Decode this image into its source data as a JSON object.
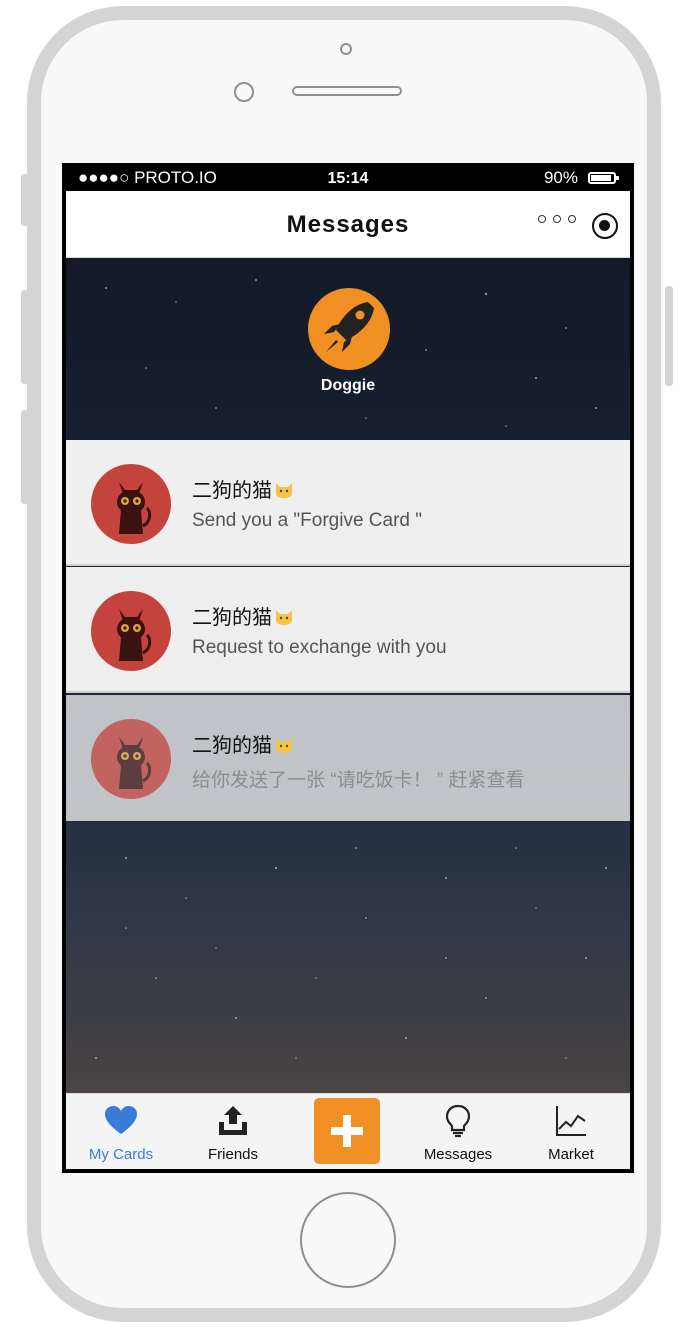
{
  "status": {
    "carrier": "●●●●○ PROTO.IO",
    "time": "15:14",
    "battery": "90%"
  },
  "nav": {
    "title": "Messages"
  },
  "header": {
    "name": "Doggie"
  },
  "messages": [
    {
      "name": "二狗的猫",
      "text": "Send you a \"Forgive Card \""
    },
    {
      "name": "二狗的猫",
      "text": "Request to exchange with you"
    },
    {
      "name": "二狗的猫",
      "text": "给你发送了一张 “请吃饭卡！ ” 赶紧查看"
    }
  ],
  "tabs": [
    {
      "label": "My Cards",
      "icon": "heart-icon",
      "active": true
    },
    {
      "label": "Friends",
      "icon": "upload-icon"
    },
    {
      "label": "",
      "icon": "plus-icon"
    },
    {
      "label": "Messages",
      "icon": "lightbulb-icon"
    },
    {
      "label": "Market",
      "icon": "chart-line-icon"
    }
  ],
  "colors": {
    "accent": "#f08f23",
    "active_tab": "#3b7bd8",
    "avatar": "#c4433d"
  }
}
